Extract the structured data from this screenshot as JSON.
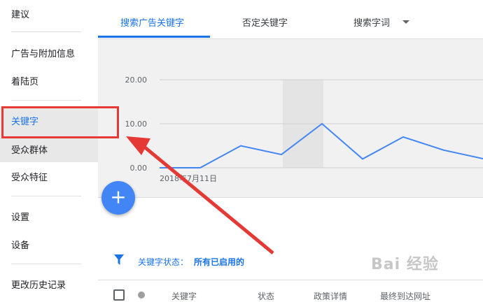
{
  "sidebar": {
    "items": [
      {
        "label": "建议"
      },
      {
        "label": "广告与附加信息"
      },
      {
        "label": "着陆页"
      },
      {
        "label": "关键字"
      },
      {
        "label": "受众群体"
      },
      {
        "label": "受众特征"
      },
      {
        "label": "设置"
      },
      {
        "label": "设备"
      },
      {
        "label": "更改历史记录"
      }
    ],
    "active_index": 3
  },
  "tabs": [
    {
      "label": "搜索广告关键字",
      "active": true
    },
    {
      "label": "否定关键字",
      "active": false
    },
    {
      "label": "搜索字词",
      "active": false
    }
  ],
  "chart_data": {
    "type": "line",
    "y_ticks": [
      "20.00",
      "10.00",
      "0.00"
    ],
    "ylim": [
      0,
      20
    ],
    "x_label_visible": "2018年7月11日",
    "series": [
      {
        "values": [
          0,
          0,
          5,
          3,
          10,
          2,
          7,
          4,
          2
        ],
        "color": "#4285f4"
      }
    ],
    "highlight_index": 3,
    "grid": true
  },
  "fab": {
    "symbol": "+"
  },
  "filter": {
    "label": "关键字状态：",
    "value": "所有已启用的"
  },
  "table": {
    "headers": [
      "关键字",
      "状态",
      "政策详情",
      "最终到达网址"
    ]
  },
  "watermark": "Bai 经验",
  "colors": {
    "accent": "#1a73e8",
    "annotation": "#e53935",
    "chart_line": "#4285f4"
  }
}
